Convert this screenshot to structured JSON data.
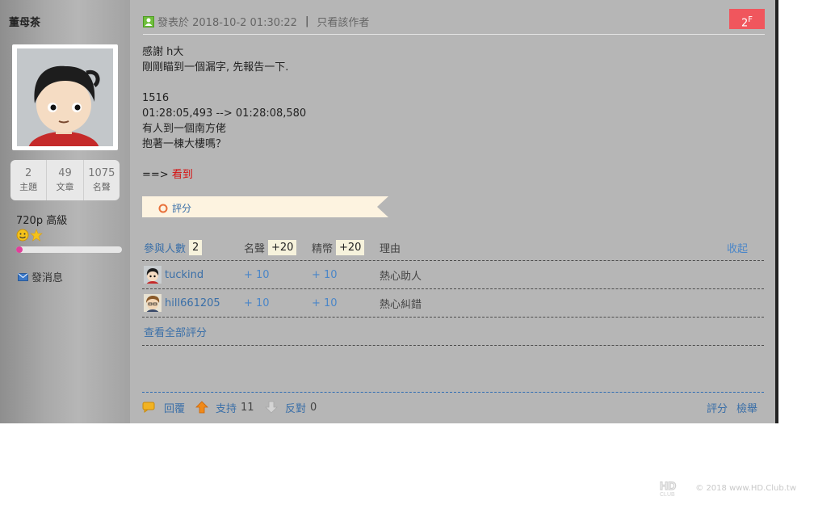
{
  "user": {
    "name": "董母茶",
    "stats": [
      {
        "value": "2",
        "label": "主題"
      },
      {
        "value": "49",
        "label": "文章"
      },
      {
        "value": "1075",
        "label": "名聲"
      }
    ],
    "rank": "720p 高級",
    "progress_fraction": 0.06,
    "send_message": "發消息"
  },
  "post": {
    "posted_label": "發表於 2018-10-2 01:30:22",
    "separator": "|",
    "only_author": "只看該作者",
    "floor_number": "2",
    "floor_suffix": "F",
    "lines": [
      "感謝 h大",
      "剛剛瞄到一個漏字, 先報告一下.",
      "",
      "1516",
      "01:28:05,493 --> 01:28:08,580",
      "有人到一個南方佬",
      "抱著一棟大樓嗎？",
      ""
    ],
    "arrow_text": "==> ",
    "highlight": "看到"
  },
  "rating": {
    "bar_label": "評分",
    "participants_label": "參與人數",
    "participants_count": "2",
    "reputation_label": "名聲",
    "reputation_total": "+20",
    "coins_label": "精幣",
    "coins_total": "+20",
    "reason_label": "理由",
    "collapse_label": "收起",
    "rows": [
      {
        "user": "tuckind",
        "reputation": "+ 10",
        "coins": "+ 10",
        "reason": "熱心助人"
      },
      {
        "user": "hill661205",
        "reputation": "+ 10",
        "coins": "+ 10",
        "reason": "熱心糾錯"
      }
    ],
    "view_all": "查看全部評分"
  },
  "footer": {
    "reply": "回覆",
    "support": "支持",
    "support_count": "11",
    "oppose": "反對",
    "oppose_count": "0",
    "rate": "評分",
    "report": "檢舉"
  },
  "watermark": {
    "logo": "HD CLUB",
    "text": "© 2018 www.HD.Club.tw"
  },
  "colors": {
    "floor_badge": "#f0565d",
    "link_blue": "#3a6fa8",
    "highlight_red": "#d61010",
    "progress": "#e0409a"
  }
}
